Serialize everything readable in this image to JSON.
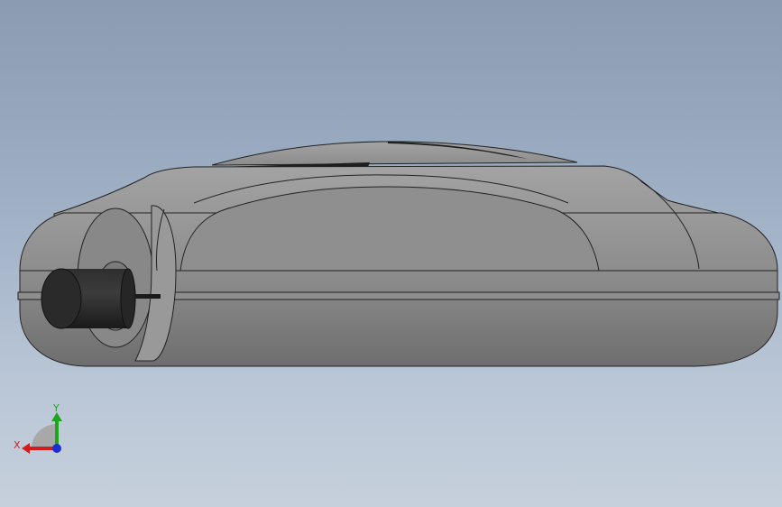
{
  "triad": {
    "x_label": "X",
    "y_label": "Y",
    "x_color": "#d41c1c",
    "y_color": "#1ea51e",
    "z_color": "#1b2fd0"
  },
  "colors": {
    "background_top": "#8a9bb2",
    "background_bottom": "#c6d0dc",
    "body_gray": "#7d7d7d",
    "connector_black": "#222222"
  }
}
